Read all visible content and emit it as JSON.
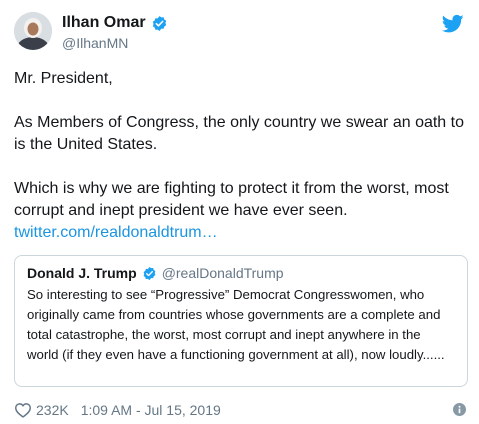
{
  "tweet": {
    "author": {
      "name": "Ilhan Omar",
      "handle": "@IlhanMN",
      "verified": true
    },
    "paragraphs": [
      "Mr. President,",
      "As Members of Congress, the only country we swear an oath to is the United States.",
      "Which is why we are fighting to protect it from the worst, most corrupt and inept president we have ever seen."
    ],
    "link_text": "twitter.com/realdonaldtrum…",
    "quoted": {
      "name": "Donald J. Trump",
      "handle": "@realDonaldTrump",
      "verified": true,
      "text": "So interesting to see “Progressive” Democrat Congresswomen, who originally came from countries whose governments are a complete and total catastrophe, the worst, most corrupt and inept anywhere in the world (if they even have a functioning government at all), now loudly......"
    },
    "likes": "232K",
    "timestamp": "1:09 AM - Jul 15, 2019"
  },
  "icons": {
    "verified": "verified-badge-icon",
    "brand": "twitter-bird-icon",
    "like": "heart-icon",
    "info": "info-icon"
  },
  "colors": {
    "brand_blue": "#1da1f2",
    "link_blue": "#1b95e0",
    "secondary_text": "#657786",
    "border": "#ccd6dd"
  }
}
